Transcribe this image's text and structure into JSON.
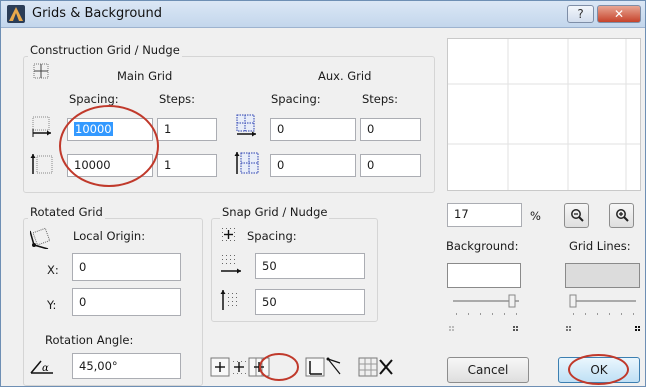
{
  "window": {
    "title": "Grids & Background",
    "help_label": "?",
    "close_label": "✕"
  },
  "construction": {
    "group_label": "Construction Grid / Nudge",
    "main_grid_label": "Main Grid",
    "aux_grid_label": "Aux. Grid",
    "spacing_label": "Spacing:",
    "steps_label": "Steps:",
    "main_spacing_x": "10000",
    "main_steps_x": "1",
    "main_spacing_y": "10000",
    "main_steps_y": "1",
    "aux_spacing_x": "0",
    "aux_steps_x": "0",
    "aux_spacing_y": "0",
    "aux_steps_y": "0"
  },
  "rotated": {
    "group_label": "Rotated Grid",
    "origin_label": "Local Origin:",
    "x_label": "X:",
    "x_value": "0",
    "y_label": "Y:",
    "y_value": "0",
    "angle_label": "Rotation Angle:",
    "angle_value": "45,00°"
  },
  "snap": {
    "group_label": "Snap Grid / Nudge",
    "spacing_label": "Spacing:",
    "spacing_x": "50",
    "spacing_y": "50"
  },
  "view": {
    "zoom_value": "17",
    "zoom_unit": "%",
    "background_label": "Background:",
    "grid_lines_label": "Grid Lines:",
    "background_color": "#ffffff",
    "grid_lines_color": "#dcdcdc",
    "background_slider_level": 0.92,
    "grid_lines_slider_level": 0.15
  },
  "buttons": {
    "cancel_label": "Cancel",
    "ok_label": "OK"
  },
  "icons": [
    "app-icon",
    "grid-icon",
    "horizontal-spacing-icon",
    "vertical-spacing-icon",
    "zoom-out-icon",
    "zoom-in-icon",
    "snap-grid-icon",
    "rotate-grid-icon",
    "origin-icon",
    "angle-icon",
    "grid-mode-off-icon",
    "grid-mode-on-icon",
    "rotated-grid-mode-icon",
    "hide-grid-icon"
  ]
}
